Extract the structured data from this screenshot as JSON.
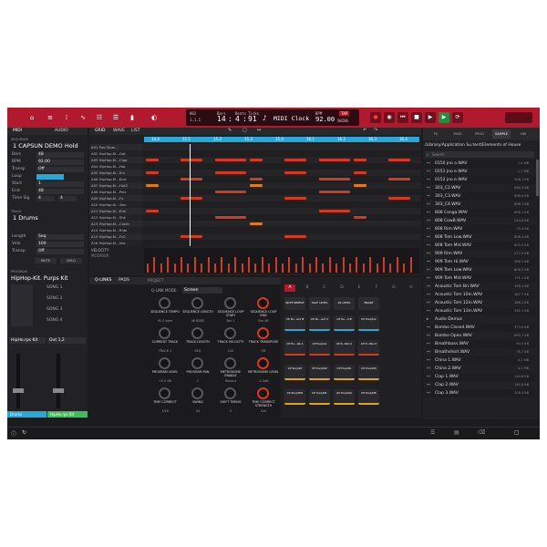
{
  "toolbar": {
    "bar": "14",
    "beat": "4",
    "tick": "91",
    "bars_label": "Bars",
    "beats_label": "Beats",
    "ticks_label": "Ticks",
    "pos_a": "002",
    "pos_b": "1.1.1",
    "clock": "MIDI Clock",
    "bpm_label": "BPM",
    "bpm": "92.00",
    "tap": "TAP",
    "swing": "SWING"
  },
  "left": {
    "tabs": [
      "MIDI",
      "AUDIO"
    ],
    "sequence_label": "SEQUENCE",
    "sequence": "1 CAPSUN DEMO Hold",
    "seq_rows": [
      {
        "k": "Bars",
        "v": "48"
      },
      {
        "k": "BPM",
        "v": "92.00"
      },
      {
        "k": "Transp",
        "v": "Off"
      },
      {
        "k": "Loop",
        "v": ""
      },
      {
        "k": "Start",
        "v": "1"
      },
      {
        "k": "End",
        "v": "48"
      },
      {
        "k": "Time Sig",
        "v": "4"
      }
    ],
    "track_label": "TRACK",
    "track": "1 Drums",
    "track_rows": [
      {
        "k": "Length",
        "v": "Seq"
      },
      {
        "k": "Velo",
        "v": "100"
      },
      {
        "k": "Transp",
        "v": "Off"
      }
    ],
    "mute": "MUTE",
    "solo": "SOLO",
    "program_label": "PROGRAM",
    "program": "HipHop-Kit. Purps Kit",
    "songs": [
      "SONG 1",
      "SONG 2",
      "SONG 3",
      "SONG 4"
    ],
    "kit": "HipHo.rps Kit",
    "out": "Out 1,2",
    "channel_a": "Drums",
    "channel_b": "HipHo.rps Kit"
  },
  "grid": {
    "tabs": [
      "GRID",
      "WAVE",
      "LIST"
    ],
    "ruler": [
      "14.4",
      "15.1",
      "15.2",
      "15.3",
      "15.4",
      "16.1",
      "16.2",
      "16.3",
      "16.4"
    ],
    "lanes": [
      {
        "id": "A01",
        "n": "Two Slow..."
      },
      {
        "id": "A02",
        "n": "HipHop.Ki...Gat"
      },
      {
        "id": "A03",
        "n": "HipHop.Ki...Clap"
      },
      {
        "id": "A04",
        "n": "HipHop.Ki...Hat"
      },
      {
        "id": "A05",
        "n": "HipHop.Ki...Snr"
      },
      {
        "id": "A06",
        "n": "HipHop.Ki...Kick"
      },
      {
        "id": "A07",
        "n": "HipHop.Ki...Hat2"
      },
      {
        "id": "A08",
        "n": "HipHop.Ki...Perc"
      },
      {
        "id": "A09",
        "n": "HipHop.Ki...Fx"
      },
      {
        "id": "A10",
        "n": "HipHop.Ki...Tom"
      },
      {
        "id": "A11",
        "n": "HipHop.Ki...Rim"
      },
      {
        "id": "A12",
        "n": "HipHop.Ki...Shk"
      },
      {
        "id": "A13",
        "n": "HipHop.Ki...Crash"
      },
      {
        "id": "A14",
        "n": "HipHop.Ki...Ride"
      },
      {
        "id": "A15",
        "n": "HipHop.Ki...Fx2"
      },
      {
        "id": "A16",
        "n": "HipHop.Ki...Vox"
      }
    ],
    "velocity": "VELOCITY",
    "modifier": "MODIFIER"
  },
  "qlink": {
    "tabs": [
      "Q-LINKS",
      "PADS"
    ],
    "project": "PROJECT",
    "mode_label": "Q-LINK MODE:",
    "mode": "Screen",
    "knobs": [
      {
        "l": "SEQUENCE TEMPO",
        "v": "92.0 bpm"
      },
      {
        "l": "SEQUENCE LENGTH",
        "v": "48 BARS"
      },
      {
        "l": "SEQUENCE LOOP START",
        "v": "Bar 1"
      },
      {
        "l": "SEQUENCE LOOP END",
        "v": "Bar 48"
      },
      {
        "l": "CURRENT TRACK",
        "v": "TRACK 1"
      },
      {
        "l": "TRACK LENGTH",
        "v": "SEQ"
      },
      {
        "l": "TRACK VELOCITY",
        "v": "100"
      },
      {
        "l": "TRACK TRANSPOSE",
        "v": "Off"
      },
      {
        "l": "PROGRAM LEVEL",
        "v": "+0.0 dB"
      },
      {
        "l": "PROGRAM PAN",
        "v": "C"
      },
      {
        "l": "METRONOME ENABLE",
        "v": "Record"
      },
      {
        "l": "METRONOME LEVEL",
        "v": "-1.0dB"
      },
      {
        "l": "TIME CORRECT",
        "v": "1/16"
      },
      {
        "l": "SWING",
        "v": "50"
      },
      {
        "l": "SHIFT TIMING",
        "v": "0"
      },
      {
        "l": "TIME CORRECT STRENGTH",
        "v": "100"
      }
    ]
  },
  "pads": {
    "banks": [
      "A",
      "B",
      "C",
      "D",
      "E",
      "F",
      "G",
      "H"
    ],
    "funcs": [
      "NOTE REPEAT",
      "HALF LEVEL",
      "16 LEVEL",
      "ERASE"
    ],
    "labels": [
      "CP Pu...ard B",
      "CP Pu...ard C",
      "CP Pu...d B",
      "CP PurpSnr",
      "CP Pu...lat A",
      "CP PurpG1",
      "CP P...Perc1",
      "CP P...Perc2",
      "CP PurpSlf",
      "CP PurpSt2",
      "CP PurpStr",
      "CP PurpSt3",
      "CP PurpSlf2",
      "CP PurpSt1",
      "CP PurpSt4",
      "CP PurpSt5"
    ]
  },
  "browser": {
    "tabs": [
      "FX",
      "PACK",
      "PROG",
      "SAMPLE",
      "HW"
    ],
    "path": "/Library/Application Su.tent/Elements of House",
    "search": "Search",
    "files": [
      {
        "n": "0150 jno a.WAV",
        "s": "1.4 MB"
      },
      {
        "n": "0151 jno e.WAV",
        "s": "1.1 MB"
      },
      {
        "n": "0152 jno e.WAV",
        "s": "908.1 KB"
      },
      {
        "n": "303_C2.WAV",
        "s": "584.3 KB"
      },
      {
        "n": "303_C3.WAV",
        "s": "698.6 KB"
      },
      {
        "n": "303_C4.WAV",
        "s": "698.1 KB"
      },
      {
        "n": "808 Conga.WAV",
        "s": "698.1 KB"
      },
      {
        "n": "808 CowB.WAV",
        "s": "244.6 KB"
      },
      {
        "n": "808 Rim.WAV",
        "s": "70.4 KB"
      },
      {
        "n": "808 Tom Low.WAV",
        "s": "808.3 KB"
      },
      {
        "n": "808 Tom Mid.WAV",
        "s": "603.5 KB"
      },
      {
        "n": "909 Rim.WAV",
        "s": "277.0 KB"
      },
      {
        "n": "909 Tom Hi.WAV",
        "s": "568.2 KB"
      },
      {
        "n": "909 Tom Low.WAV",
        "s": "806.2 KB"
      },
      {
        "n": "909 Tom Mid.WAV",
        "s": "171.1 KB"
      },
      {
        "n": "Acoustic Tom Bri.WAV",
        "s": "458.5 KB"
      },
      {
        "n": "Acoustic Tom 10in.WAV",
        "s": "487.7 KB"
      },
      {
        "n": "Acoustic Tom 12in.WAV",
        "s": "388.2 KB"
      },
      {
        "n": "Acoustic Tom 13in.WAV",
        "s": "362.1 KB"
      },
      {
        "n": "Audio Demos",
        "s": ""
      },
      {
        "n": "Bombo Closed.WAV",
        "s": "373.0 KB"
      },
      {
        "n": "Bombo Open.WAV",
        "s": "693.7 KB"
      },
      {
        "n": "Breathbass.WAV",
        "s": "94.5 KB"
      },
      {
        "n": "Breathshort.WAV",
        "s": "76.7 KB"
      },
      {
        "n": "China 1.WAV",
        "s": "4.2 MB"
      },
      {
        "n": "China 2.WAV",
        "s": "4.1 MB"
      },
      {
        "n": "Clap 1.WAV",
        "s": "140.8 KB"
      },
      {
        "n": "Clap 2.WAV",
        "s": "162.6 KB"
      },
      {
        "n": "Clap 3.WAV",
        "s": "208.4 KB"
      }
    ]
  },
  "colors": {
    "brand": "#b0192e",
    "accent_blue": "#2aa7d9",
    "note_red": "#d33a25",
    "note_orange": "#e07b1c",
    "bg": "#1c1c1e"
  }
}
